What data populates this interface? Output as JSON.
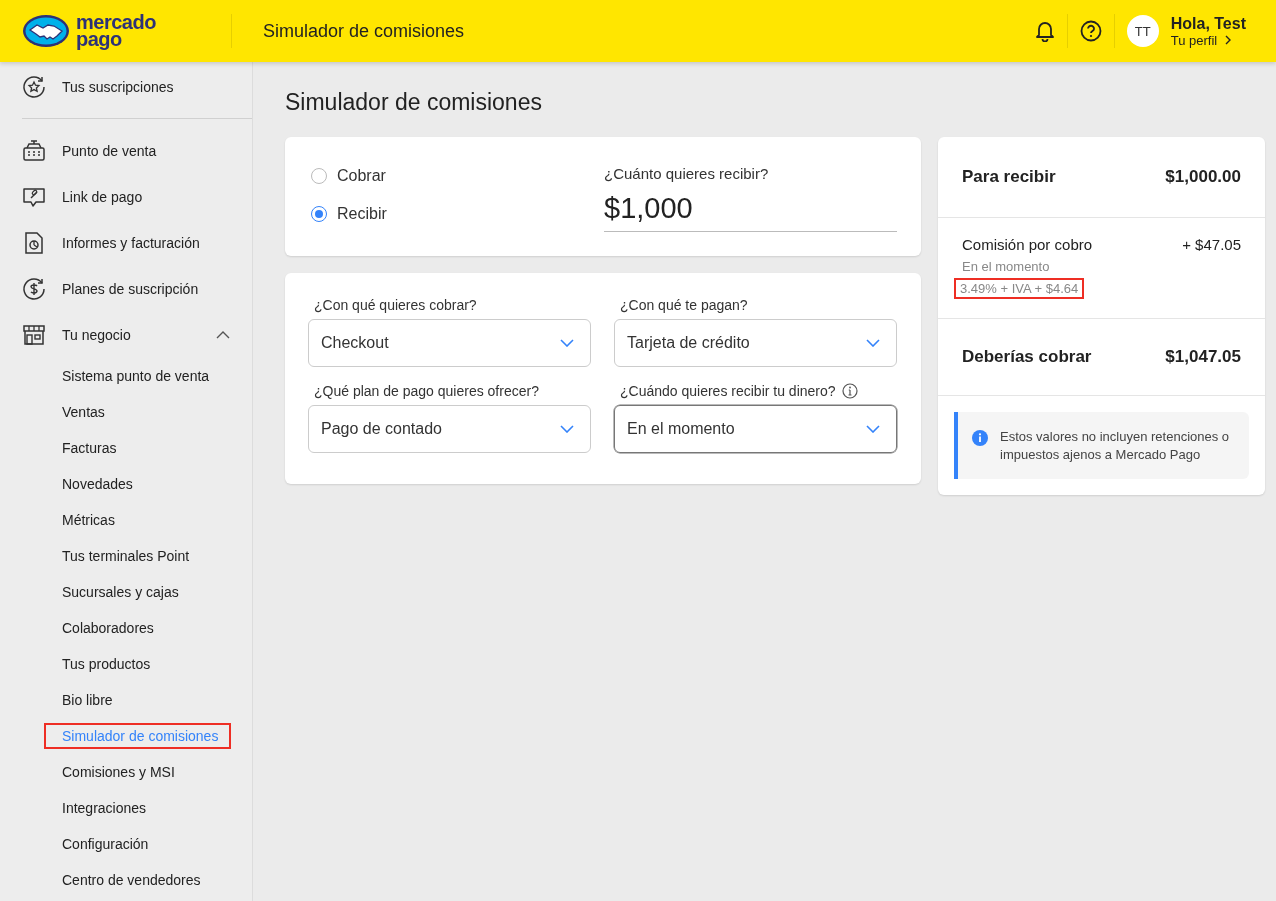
{
  "header": {
    "logo_line1": "mercado",
    "logo_line2": "pago",
    "title": "Simulador de comisiones",
    "user": {
      "initials": "TT",
      "greeting": "Hola, Test",
      "profile_link": "Tu perfil"
    }
  },
  "sidebar": {
    "items": [
      {
        "label": "Tus suscripciones"
      },
      {
        "label": "Punto de venta"
      },
      {
        "label": "Link de pago"
      },
      {
        "label": "Informes y facturación"
      },
      {
        "label": "Planes de suscripción"
      },
      {
        "label": "Tu negocio",
        "expanded": true,
        "children": [
          {
            "label": "Sistema punto de venta",
            "selected": false,
            "highlighted": false
          },
          {
            "label": "Ventas",
            "selected": false,
            "highlighted": false
          },
          {
            "label": "Facturas",
            "selected": false,
            "highlighted": false
          },
          {
            "label": "Novedades",
            "selected": false,
            "highlighted": false
          },
          {
            "label": "Métricas",
            "selected": false,
            "highlighted": false
          },
          {
            "label": "Tus terminales Point",
            "selected": false,
            "highlighted": false
          },
          {
            "label": "Sucursales y cajas",
            "selected": false,
            "highlighted": false
          },
          {
            "label": "Colaboradores",
            "selected": false,
            "highlighted": false
          },
          {
            "label": "Tus productos",
            "selected": false,
            "highlighted": false
          },
          {
            "label": "Bio libre",
            "selected": false,
            "highlighted": false
          },
          {
            "label": "Simulador de comisiones",
            "selected": true,
            "highlighted": true
          },
          {
            "label": "Comisiones y MSI",
            "selected": false,
            "highlighted": false
          },
          {
            "label": "Integraciones",
            "selected": false,
            "highlighted": false
          },
          {
            "label": "Configuración",
            "selected": false,
            "highlighted": false
          },
          {
            "label": "Centro de vendedores",
            "selected": false,
            "highlighted": false
          }
        ]
      }
    ]
  },
  "main": {
    "page_title": "Simulador de comisiones",
    "mode_options": [
      {
        "label": "Cobrar",
        "selected": false
      },
      {
        "label": "Recibir",
        "selected": true
      }
    ],
    "amount": {
      "label": "¿Cuánto quieres recibir?",
      "value": "$1,000"
    },
    "selects": [
      {
        "label": "¿Con qué quieres cobrar?",
        "value": "Checkout",
        "focused": false,
        "info_icon": false
      },
      {
        "label": "¿Con qué te pagan?",
        "value": "Tarjeta de crédito",
        "focused": false,
        "info_icon": false
      },
      {
        "label": "¿Qué plan de pago quieres ofrecer?",
        "value": "Pago de contado",
        "focused": false,
        "info_icon": false
      },
      {
        "label": "¿Cuándo quieres recibir tu dinero?",
        "value": "En el momento",
        "focused": true,
        "info_icon": true
      }
    ]
  },
  "summary": {
    "rows": [
      {
        "kind": "total",
        "label": "Para recibir",
        "value": "$1,000.00"
      },
      {
        "kind": "fee",
        "label": "Comisión por cobro",
        "value": "+ $47.05",
        "detail": "En el momento",
        "formula": "3.49% + IVA + $4.64",
        "highlighted": true
      },
      {
        "kind": "total",
        "label": "Deberías cobrar",
        "value": "$1,047.05"
      }
    ],
    "notice": "Estos valores no incluyen retenciones o impuestos ajenos a Mercado Pago"
  }
}
